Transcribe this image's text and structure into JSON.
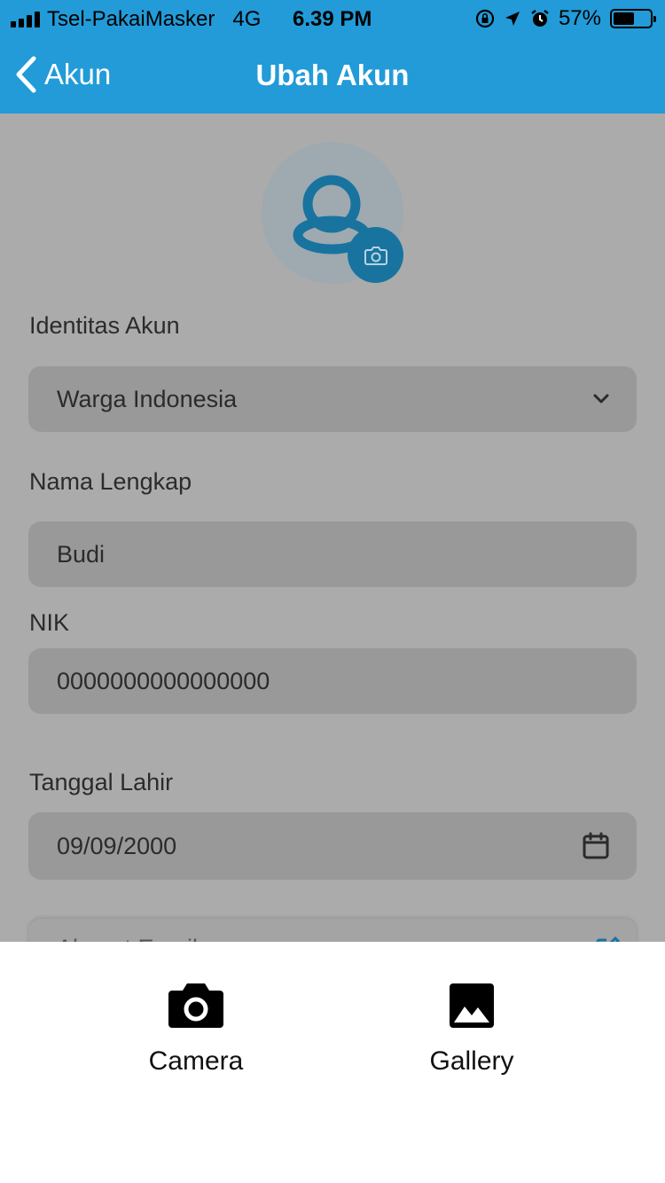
{
  "status_bar": {
    "carrier": "Tsel-PakaiMasker",
    "network": "4G",
    "time": "6.39 PM",
    "battery": "57%",
    "battery_level": 0.57,
    "icons": [
      "signal-icon",
      "rotation-lock-icon",
      "location-icon",
      "alarm-icon",
      "battery-icon"
    ]
  },
  "nav": {
    "back_label": "Akun",
    "title": "Ubah Akun"
  },
  "profile": {
    "avatar_icon": "user-icon",
    "camera_icon": "camera-icon"
  },
  "form": {
    "identity_label": "Identitas Akun",
    "identity_value": "Warga Indonesia",
    "name_label": "Nama Lengkap",
    "name_value": "Budi",
    "nik_label": "NIK",
    "nik_value": "0000000000000000",
    "dob_label": "Tanggal Lahir",
    "dob_value": "09/09/2000",
    "email_label": "Alamat Email"
  },
  "sheet": {
    "camera_label": "Camera",
    "gallery_label": "Gallery"
  },
  "colors": {
    "accent": "#229bd8",
    "overlay_bg": "#ababab",
    "field_bg": "#999999",
    "camera_badge": "#18749f"
  }
}
